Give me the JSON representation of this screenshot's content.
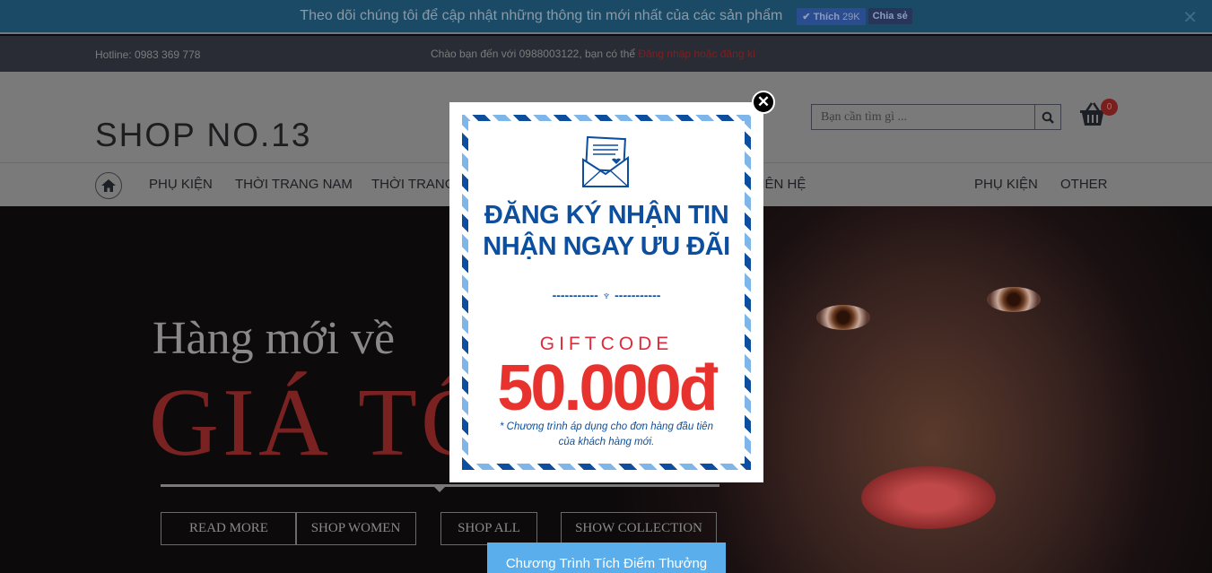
{
  "topbar": {
    "message": "Theo dõi chúng tôi để cập nhật những thông tin mới nhất của các sản phẩm",
    "like_label": "Thích",
    "like_count": "29K",
    "share_label": "Chia sẻ",
    "close": "✕"
  },
  "infobar": {
    "hotline": "Hotline: 0983 369 778",
    "welcome": "Chào bạn đến với 0988003122, bạn có thể ",
    "login_link": "Đăng nhập hoặc đăng kí"
  },
  "header": {
    "logo": "SHOP NO.13",
    "search_placeholder": "Bạn cần tìm gì ...",
    "cart_count": "0"
  },
  "nav": {
    "items": [
      "PHỤ KIỆN",
      "THỜI TRANG NAM",
      "THỜI TRANG",
      "LIÊN HỆ",
      "PHỤ KIỆN",
      "OTHER"
    ]
  },
  "hero": {
    "line1": "Hàng mới về",
    "line2": "GIÁ TỐT",
    "buttons": [
      "READ MORE",
      "SHOP WOMEN",
      "SHOP ALL",
      "SHOW COLLECTION"
    ]
  },
  "popup": {
    "title1": "ĐĂNG KÝ NHẬN TIN",
    "title2": "NHẬN NGAY ƯU ĐÃI",
    "divider": "----------- ♆ -----------",
    "giftcode": "GIFTCODE",
    "amount": "50.000đ",
    "note1": "* Chương trình áp dụng cho đơn hàng đầu tiên",
    "note2": "của khách hàng mới.",
    "close": "✕"
  },
  "reward_button": "Chương Trình Tích Điểm Thưởng"
}
